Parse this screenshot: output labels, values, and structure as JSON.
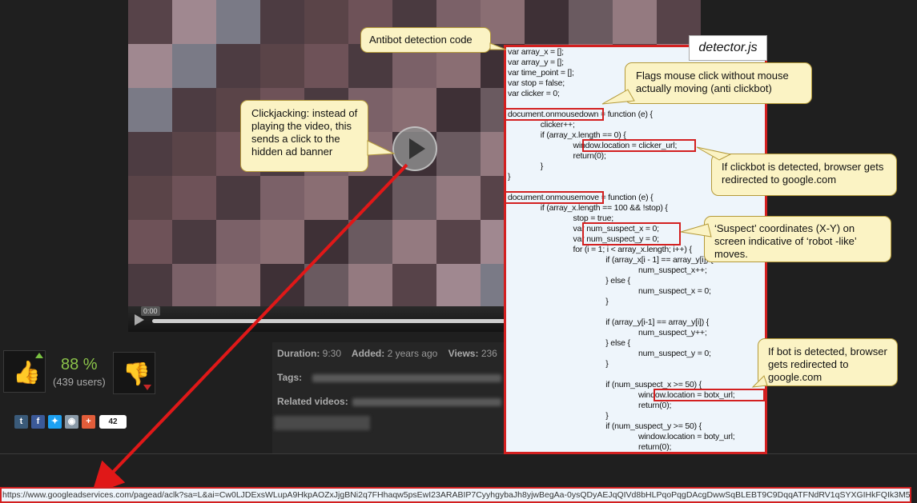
{
  "player": {
    "time": "0:00",
    "play_icon": "play-icon"
  },
  "rating": {
    "percent": "88 %",
    "users": "(439 users)",
    "like_icon": "thumbs-up-icon",
    "dislike_icon": "thumbs-down-icon"
  },
  "share": {
    "count": "42",
    "networks": [
      "t",
      "f",
      "twitter",
      "reddit",
      "+"
    ]
  },
  "info": {
    "duration_label": "Duration:",
    "duration_value": "9:30",
    "added_label": "Added:",
    "added_value": "2 years ago",
    "views_label": "Views:",
    "views_value": "236",
    "tags_label": "Tags:",
    "related_label": "Related videos:"
  },
  "annotations": {
    "antibot": "Antibot detection code",
    "file": "detector.js",
    "mouse_click": "Flags mouse click without mouse actually moving (anti clickbot)",
    "clickjacking": "Clickjacking: instead of playing the video, this sends a click to the hidden ad banner",
    "clickbot": "If clickbot is detected, browser gets redirected to google.com",
    "suspect": "‘Suspect’ coordinates (X-Y) on screen indicative of ‘robot -like’ moves.",
    "bot": "If bot is detected, browser gets redirected to google.com"
  },
  "code_lines": [
    "var array_x = [];",
    "var array_y = [];",
    "var time_point = [];",
    "var stop = false;",
    "var clicker = 0;",
    "",
    "document.onmousedown = function (e) {",
    "               clicker++;",
    "               if (array_x.length == 0) {",
    "                              window.location = clicker_url;",
    "                              return(0);",
    "               }",
    "}",
    "",
    "document.onmousemove = function (e) {",
    "               if (array_x.length == 100 && !stop) {",
    "                              stop = true;",
    "                              var num_suspect_x = 0;",
    "                              var num_suspect_y = 0;",
    "                              for (i = 1; i < array_x.length; i++) {",
    "                                             if (array_x[i - 1] == array_y[i]) {",
    "                                                            num_suspect_x++;",
    "                                             } else {",
    "                                                            num_suspect_x = 0;",
    "                                             }",
    "",
    "                                             if (array_y[i-1] == array_y[i]) {",
    "                                                            num_suspect_y++;",
    "                                             } else {",
    "                                                            num_suspect_y = 0;",
    "                                             }",
    "",
    "                                             if (num_suspect_x >= 50) {",
    "                                                            window.location = botx_url;",
    "                                                            return(0);",
    "                                             }",
    "                                             if (num_suspect_y >= 50) {",
    "                                                            window.location = boty_url;",
    "                                                            return(0);"
  ],
  "url": "https://www.googleadservices.com/pagead/aclk?sa=L&ai=Cw0LJDExsWLupA9HkpAOZxJjgBNi2q7FHhaqw5psEwI23ARABIP7CyyhgybaJh8yjwBegAa-0ysQDyAEJqQIVd8bHLPqoPqgDAcgDwwSqBLEBT9C9DqqATFNdRV1qSYXGIHkFQIk3M5"
}
